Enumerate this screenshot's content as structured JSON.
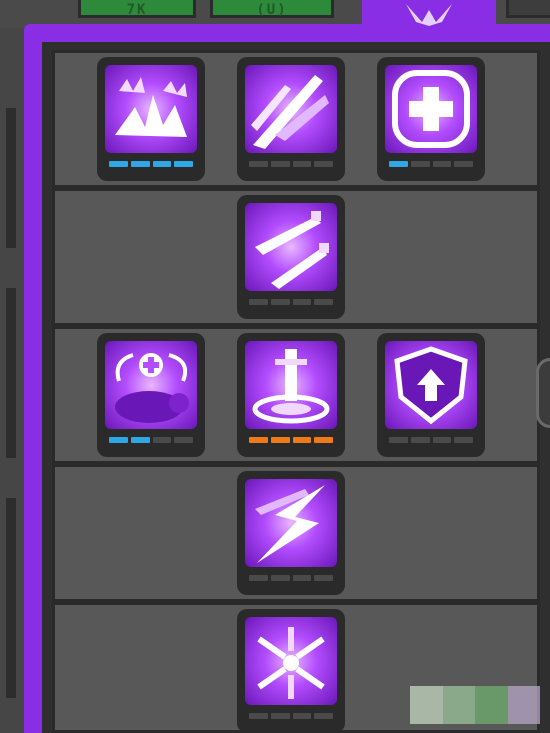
{
  "tabs": [
    {
      "name": "tab-left-1",
      "glyph": "7K",
      "state": "inactive"
    },
    {
      "name": "tab-left-2",
      "glyph": "(U)",
      "state": "inactive"
    },
    {
      "name": "tab-talents",
      "icon": "talent-crest-icon",
      "state": "active"
    },
    {
      "name": "tab-right",
      "state": "inactive"
    }
  ],
  "colors": {
    "panel_purple": "#8a2ee6",
    "pip_blue": "#2fa6e6",
    "pip_orange": "#f07a1a",
    "pip_empty": "#4a4a4a"
  },
  "skill_rows": [
    {
      "skills": [
        {
          "icon": "claw-burst-icon",
          "level": 4,
          "max_level": 4,
          "pip_color": "blue"
        },
        {
          "icon": "slash-strike-icon",
          "level": 0,
          "max_level": 4,
          "pip_color": "empty"
        },
        {
          "icon": "heal-cross-icon",
          "level": 1,
          "max_level": 4,
          "pip_color": "blue"
        }
      ]
    },
    {
      "skills": [
        {
          "icon": "twin-daggers-icon",
          "level": 0,
          "max_level": 4,
          "pip_color": "empty"
        }
      ]
    },
    {
      "skills": [
        {
          "icon": "pet-heal-icon",
          "level": 2,
          "max_level": 4,
          "pip_color": "blue"
        },
        {
          "icon": "sword-altar-icon",
          "level": 4,
          "max_level": 4,
          "pip_color": "orange"
        },
        {
          "icon": "shield-up-icon",
          "level": 0,
          "max_level": 4,
          "pip_color": "empty"
        }
      ]
    },
    {
      "skills": [
        {
          "icon": "lightning-dash-icon",
          "level": 0,
          "max_level": 4,
          "pip_color": "empty"
        }
      ]
    },
    {
      "skills": [
        {
          "icon": "blade-storm-icon",
          "level": 0,
          "max_level": 4,
          "pip_color": "empty"
        }
      ]
    }
  ]
}
